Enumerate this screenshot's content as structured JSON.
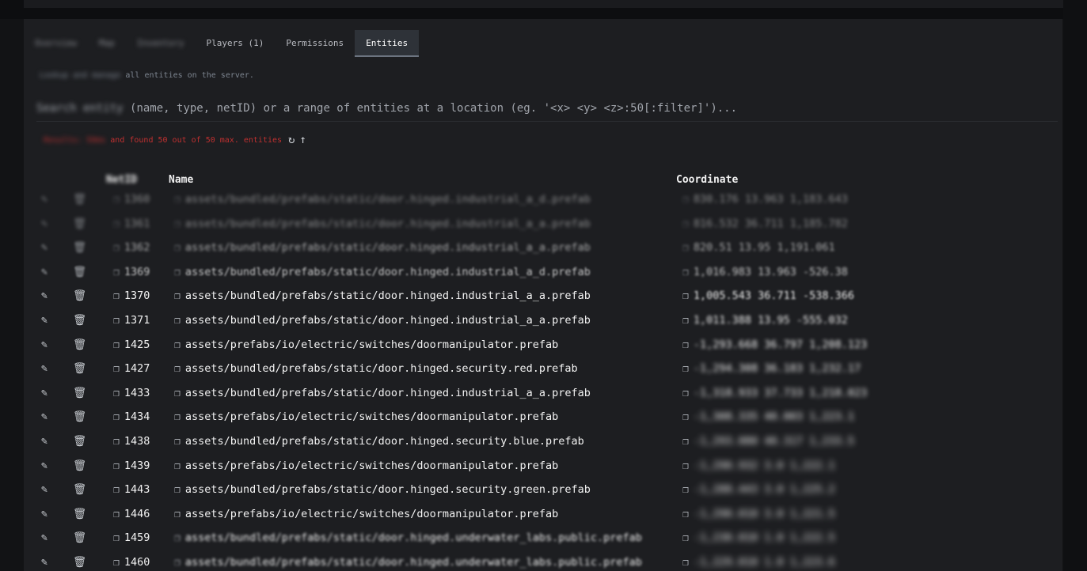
{
  "tabs": [
    {
      "label": "Overview",
      "blurred": true
    },
    {
      "label": "Map",
      "blurred": true
    },
    {
      "label": "Inventory",
      "blurred": true
    },
    {
      "label": "Players (1)",
      "blurred": false
    },
    {
      "label": "Permissions",
      "blurred": false
    },
    {
      "label": "Entities",
      "blurred": false,
      "active": true
    }
  ],
  "description": {
    "blurred_part": "Lookup and manage",
    "visible_part": "all entities on the server."
  },
  "search": {
    "blurred_part": "Search entity",
    "text": "(name, type, netID) or a range of entities at a location (eg. '<x> <y> <z>:50[:filter]')..."
  },
  "status": {
    "blurred_part": "Results: 50ms",
    "text": "and found 50 out of 50 max. entities",
    "refresh_icon": "refresh-icon",
    "sort_icon": "arrow-up-icon"
  },
  "table": {
    "headers": {
      "netid": "NetID",
      "name": "Name",
      "coordinate": "Coordinate"
    },
    "rows": [
      {
        "netid": "1360",
        "name": "assets/bundled/prefabs/static/door.hinged.industrial_a_d.prefab",
        "coord": "830.176 13.963 1,183.643"
      },
      {
        "netid": "1361",
        "name": "assets/bundled/prefabs/static/door.hinged.industrial_a_a.prefab",
        "coord": "816.532 36.711 1,185.782"
      },
      {
        "netid": "1362",
        "name": "assets/bundled/prefabs/static/door.hinged.industrial_a_a.prefab",
        "coord": "820.51 13.95 1,191.061"
      },
      {
        "netid": "1369",
        "name": "assets/bundled/prefabs/static/door.hinged.industrial_a_d.prefab",
        "coord": "1,016.983 13.963 -526.38"
      },
      {
        "netid": "1370",
        "name": "assets/bundled/prefabs/static/door.hinged.industrial_a_a.prefab",
        "coord": "1,005.543 36.711 -538.366"
      },
      {
        "netid": "1371",
        "name": "assets/bundled/prefabs/static/door.hinged.industrial_a_a.prefab",
        "coord": "1,011.388 13.95 -555.032"
      },
      {
        "netid": "1425",
        "name": "assets/prefabs/io/electric/switches/doormanipulator.prefab",
        "coord": "-1,293.668 36.797 1,208.123"
      },
      {
        "netid": "1427",
        "name": "assets/bundled/prefabs/static/door.hinged.security.red.prefab",
        "coord": "-1,294.308 36.183 1,232.17"
      },
      {
        "netid": "1433",
        "name": "assets/bundled/prefabs/static/door.hinged.industrial_a_a.prefab",
        "coord": "-1,318.933 37.733 1,218.023"
      },
      {
        "netid": "1434",
        "name": "assets/prefabs/io/electric/switches/doormanipulator.prefab",
        "coord": "-1,308.335 40.003 1,223.1"
      },
      {
        "netid": "1438",
        "name": "assets/bundled/prefabs/static/door.hinged.security.blue.prefab",
        "coord": "-1,293.080 40.317 1,233.5"
      },
      {
        "netid": "1439",
        "name": "assets/prefabs/io/electric/switches/doormanipulator.prefab",
        "coord": "-1,290.932 3.0 1,222.1"
      },
      {
        "netid": "1443",
        "name": "assets/bundled/prefabs/static/door.hinged.security.green.prefab",
        "coord": "-1,288.443 3.0 1,225.2"
      },
      {
        "netid": "1446",
        "name": "assets/prefabs/io/electric/switches/doormanipulator.prefab",
        "coord": "-1,290.010 3.0 1,221.5"
      },
      {
        "netid": "1459",
        "name": "assets/bundled/prefabs/static/door.hinged.underwater_labs.public.prefab",
        "coord": "-1,230.010 1.0 1,222.5"
      },
      {
        "netid": "1460",
        "name": "assets/bundled/prefabs/static/door.hinged.underwater_labs.public.prefab",
        "coord": "-1,229.010 1.0 1,223.6"
      }
    ]
  },
  "icons": {
    "edit": "pencil-icon",
    "delete": "trash-icon",
    "copy": "copy-icon"
  }
}
